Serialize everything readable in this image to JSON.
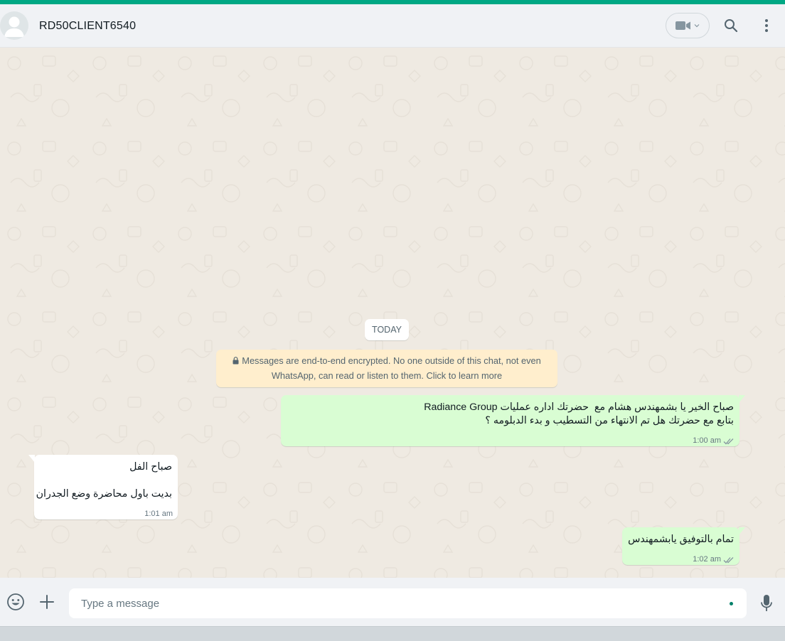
{
  "header": {
    "contact_name": "RD50CLIENT6540",
    "icons": [
      "default-avatar-icon",
      "video-call-icon",
      "chevron-down-icon",
      "search-icon",
      "menu-icon"
    ]
  },
  "chat": {
    "date_divider": "TODAY",
    "encryption_notice": {
      "line1": "Messages are end-to-end encrypted. No one outside of this chat, not even",
      "line2": "WhatsApp, can read or listen to them. Click to learn more"
    },
    "messages": [
      {
        "direction": "outgoing",
        "lines": [
          "صباح الخير يا بشمهندس هشام مع  حضرتك اداره عمليات Radiance Group",
          "بتابع مع حضرتك هل تم الانتهاء من التسطيب و بدء الدبلومه ؟"
        ],
        "time": "1:00 am",
        "status": "read"
      },
      {
        "direction": "incoming",
        "lines": [
          "صباح الفل",
          "",
          "بديت باول محاضرة وضع الجدران"
        ],
        "time": "1:01 am"
      },
      {
        "direction": "outgoing",
        "lines": [
          "تمام بالتوفيق يابشمهندس"
        ],
        "time": "1:02 am",
        "status": "read"
      }
    ]
  },
  "composer": {
    "placeholder": "Type a message",
    "icons": [
      "emoji-icon",
      "attach-plus-icon",
      "microphone-icon"
    ]
  },
  "colors": {
    "accent": "#00a884",
    "outgoing_bubble": "#d9fdd3",
    "incoming_bubble": "#ffffff",
    "chat_background": "#efeae2",
    "encryption_notice_bg": "#ffeecd"
  }
}
